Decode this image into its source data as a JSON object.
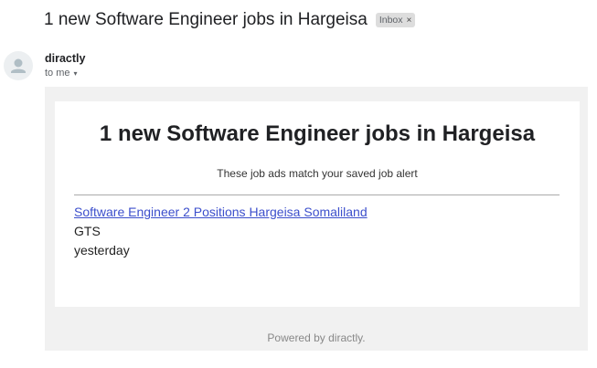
{
  "subject": "1 new Software Engineer jobs in Hargeisa",
  "label_chip": {
    "text": "Inbox",
    "close": "×"
  },
  "sender": {
    "name": "diractly",
    "recipient": "to me",
    "caret": "▾"
  },
  "email": {
    "title": "1 new Software Engineer jobs in Hargeisa",
    "subtitle": "These job ads match your saved job alert",
    "jobs": [
      {
        "title": "Software Engineer 2 Positions Hargeisa Somaliland",
        "company": "GTS",
        "posted": "yesterday"
      }
    ],
    "footer": "Powered by diractly."
  },
  "colors": {
    "link": "#3c4fcc",
    "chip_bg": "#dddddd",
    "email_bg": "#f1f1f1"
  },
  "icons": {
    "avatar": "person-icon"
  }
}
